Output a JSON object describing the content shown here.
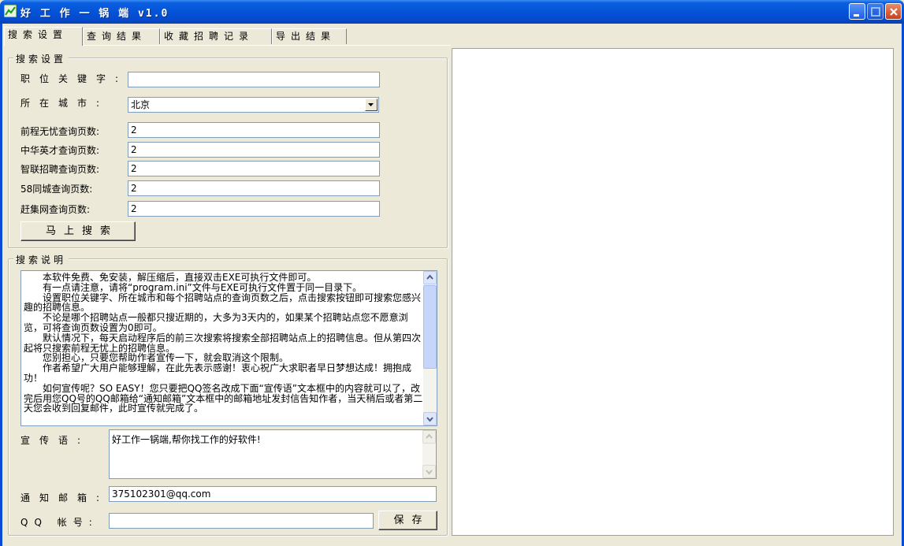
{
  "window": {
    "title": "好 工 作 一 锅 端 v1.0"
  },
  "tabs": [
    {
      "label": "搜索设置",
      "active": true
    },
    {
      "label": "查询结果",
      "active": false
    },
    {
      "label": "收藏招聘记录",
      "active": false
    },
    {
      "label": "导出结果",
      "active": false
    }
  ],
  "search_settings": {
    "group_title": "搜索设置",
    "keyword_label": "职位关键字:",
    "keyword_value": "",
    "city_label": "所在城市:",
    "city_value": "北京",
    "sites": [
      {
        "label": "前程无忧查询页数:",
        "value": "2"
      },
      {
        "label": "中华英才查询页数:",
        "value": "2"
      },
      {
        "label": "智联招聘查询页数:",
        "value": "2"
      },
      {
        "label": "58同城查询页数:",
        "value": "2"
      },
      {
        "label": "赶集网查询页数:",
        "value": "2"
      }
    ],
    "search_button": "马上搜索"
  },
  "search_help": {
    "group_title": "搜索说明",
    "paragraphs": [
      "本软件免费、免安装，解压缩后，直接双击EXE可执行文件即可。",
      "有一点请注意，请将“program.ini”文件与EXE可执行文件置于同一目录下。",
      "设置职位关键字、所在城市和每个招聘站点的查询页数之后，点击搜索按钮即可搜索您感兴趣的招聘信息。",
      "不论是哪个招聘站点一般都只搜近期的，大多为3天内的，如果某个招聘站点您不愿意浏览，可将查询页数设置为0即可。",
      "默认情况下，每天启动程序后的前三次搜索将搜索全部招聘站点上的招聘信息。但从第四次起将只搜索前程无忧上的招聘信息。",
      "您别担心，只要您帮助作者宣传一下，就会取消这个限制。",
      "作者希望广大用户能够理解，在此先表示感谢！衷心祝广大求职者早日梦想达成！拥抱成功！",
      "如何宣传呢？SO EASY！您只要把QQ签名改成下面“宣传语”文本框中的内容就可以了，改完后用您QQ号的QQ邮箱给“通知邮箱”文本框中的邮箱地址发封信告知作者，当天稍后或者第二天您会收到回复邮件，此时宣传就完成了。"
    ],
    "slogan_label": "宣传语:",
    "slogan_value": "好工作一锅端,帮你找工作的好软件!",
    "email_label": "通知邮箱:",
    "email_value": "375102301@qq.com",
    "qq_label": "QQ 帐号:",
    "qq_value": "",
    "save_button": "保存"
  },
  "colors": {
    "titlebar": "#0553d8",
    "background": "#ece9d8",
    "input_border": "#7f9db9"
  }
}
